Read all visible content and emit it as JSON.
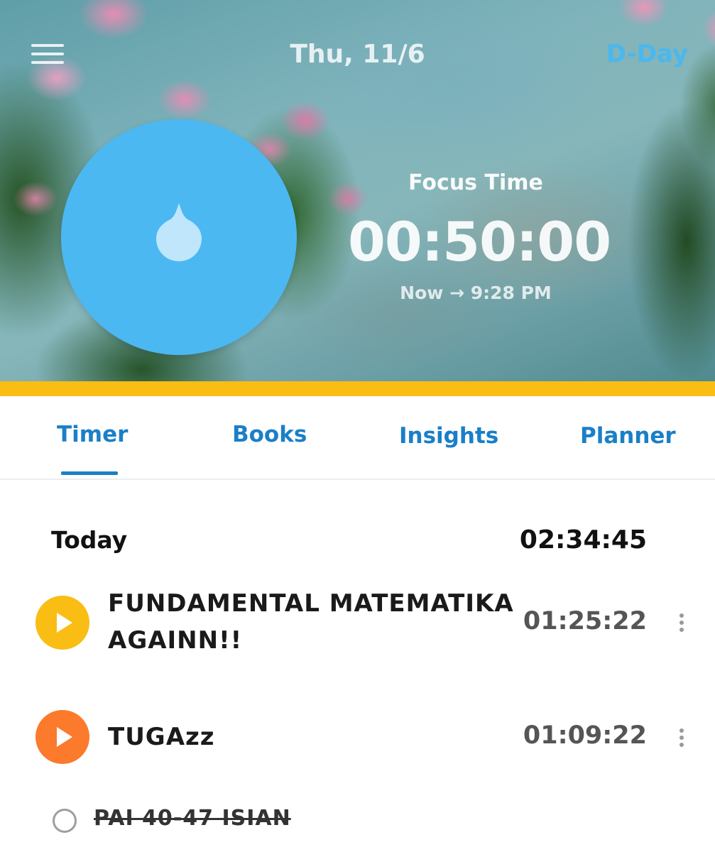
{
  "header": {
    "date": "Thu, 11/6",
    "dday_label": "D-Day",
    "focus_label": "Focus Time",
    "focus_time": "00:50:00",
    "end_time": "Now → 9:28 PM"
  },
  "tabs": [
    {
      "label": "Timer",
      "active": true
    },
    {
      "label": "Books",
      "active": false
    },
    {
      "label": "Insights",
      "active": false
    },
    {
      "label": "Planner",
      "active": false
    }
  ],
  "today": {
    "label": "Today",
    "total": "02:34:45"
  },
  "subjects": [
    {
      "name": "FUNDAMENTAL MATEMATIKA AGAINN!!",
      "time": "01:25:22",
      "color": "#f9bd13"
    },
    {
      "name": "TUGAzz",
      "time": "01:09:22",
      "color": "#fb7a2b"
    }
  ],
  "tasks": [
    {
      "label": "PAI 40-47 ISIAN",
      "done": true
    }
  ],
  "colors": {
    "accent_bar": "#f9bd13",
    "dial": "#4bb8f2",
    "tab_text": "#1a7fc8"
  }
}
